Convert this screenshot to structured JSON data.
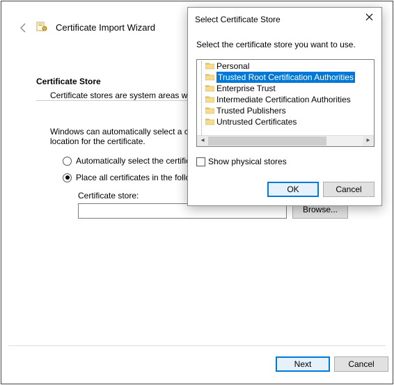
{
  "wizard": {
    "title": "Certificate Import Wizard",
    "section_title": "Certificate Store",
    "section_text1": "Certificate stores are system areas w",
    "section_text2": "Windows can automatically select a certificate store, or you can specify a location for the certificate.",
    "radio_auto": "Automatically select the certificate store based on the type of certificate",
    "radio_place": "Place all certificates in the following store",
    "store_label": "Certificate store:",
    "store_value": "",
    "browse_label": "Browse...",
    "next_label": "Next",
    "cancel_label": "Cancel"
  },
  "dialog": {
    "title": "Select Certificate Store",
    "instruction": "Select the certificate store you want to use.",
    "tree_items": [
      "Personal",
      "Trusted Root Certification Authorities",
      "Enterprise Trust",
      "Intermediate Certification Authorities",
      "Trusted Publishers",
      "Untrusted Certificates"
    ],
    "selected_index": 1,
    "show_physical": "Show physical stores",
    "ok_label": "OK",
    "cancel_label": "Cancel"
  }
}
